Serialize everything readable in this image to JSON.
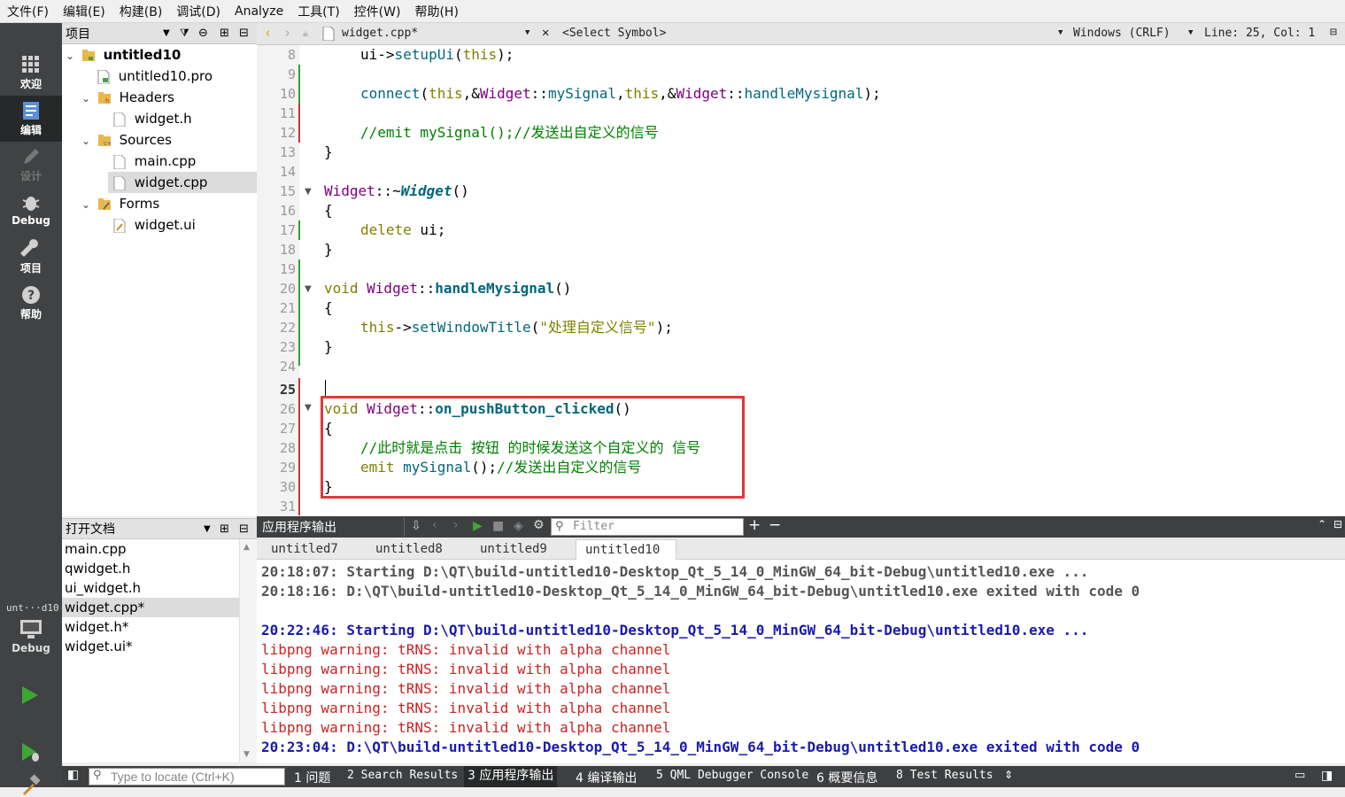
{
  "menu": [
    "文件(F)",
    "编辑(E)",
    "构建(B)",
    "调试(D)",
    "Analyze",
    "工具(T)",
    "控件(W)",
    "帮助(H)"
  ],
  "modes": [
    {
      "label": "欢迎",
      "icon": "grid-icon"
    },
    {
      "label": "编辑",
      "icon": "edit-icon"
    },
    {
      "label": "设计",
      "icon": "pencil-icon"
    },
    {
      "label": "Debug",
      "icon": "bug-icon"
    },
    {
      "label": "项目",
      "icon": "wrench-icon"
    },
    {
      "label": "帮助",
      "icon": "help-icon"
    }
  ],
  "kit": {
    "name": "unt···d10",
    "mode": "Debug"
  },
  "project_panel": {
    "title": "项目",
    "tree": [
      {
        "label": "untitled10",
        "level": 0,
        "expandable": true,
        "bold": true
      },
      {
        "label": "untitled10.pro",
        "level": 1
      },
      {
        "label": "Headers",
        "level": 1,
        "expandable": true
      },
      {
        "label": "widget.h",
        "level": 2
      },
      {
        "label": "Sources",
        "level": 1,
        "expandable": true
      },
      {
        "label": "main.cpp",
        "level": 2
      },
      {
        "label": "widget.cpp",
        "level": 2,
        "selected": true
      },
      {
        "label": "Forms",
        "level": 1,
        "expandable": true
      },
      {
        "label": "widget.ui",
        "level": 2
      }
    ]
  },
  "open_docs": {
    "title": "打开文档",
    "items": [
      "main.cpp",
      "qwidget.h",
      "ui_widget.h",
      "widget.cpp*",
      "widget.h*",
      "widget.ui*"
    ],
    "selected_index": 3
  },
  "editor_toolbar": {
    "file": "widget.cpp*",
    "symbol": "<Select Symbol>",
    "line_ending": "Windows (CRLF)",
    "position": "Line: 25, Col: 1"
  },
  "code_lines": [
    {
      "n": "8"
    },
    {
      "n": "9"
    },
    {
      "n": "10"
    },
    {
      "n": "11"
    },
    {
      "n": "12"
    },
    {
      "n": "13"
    },
    {
      "n": "14"
    },
    {
      "n": "15"
    },
    {
      "n": "16"
    },
    {
      "n": "17"
    },
    {
      "n": "18"
    },
    {
      "n": "19"
    },
    {
      "n": "20"
    },
    {
      "n": "21"
    },
    {
      "n": "22"
    },
    {
      "n": "23"
    },
    {
      "n": "24"
    },
    {
      "n": "25"
    },
    {
      "n": "26"
    },
    {
      "n": "27"
    },
    {
      "n": "28"
    },
    {
      "n": "29"
    },
    {
      "n": "30"
    },
    {
      "n": "31"
    }
  ],
  "code": {
    "l8a": "ui->",
    "l8b": "setupUi",
    "l8c": "(",
    "l8d": "this",
    "l8e": ");",
    "l10a": "connect",
    "l10b": "(",
    "l10c": "this",
    "l10d": ",&",
    "l10e": "Widget",
    "l10f": "::",
    "l10g": "mySignal",
    "l10h": ",",
    "l10i": "this",
    "l10j": ",&",
    "l10k": "Widget",
    "l10l": "::",
    "l10m": "handleMysignal",
    "l10n": ");",
    "l12": "//emit mySignal();//发送出自定义的信号",
    "l13": "}",
    "l15a": "Widget",
    "l15b": "::~",
    "l15c": "Widget",
    "l15d": "()",
    "l16": "{",
    "l17a": "delete",
    "l17b": " ui;",
    "l18": "}",
    "l20a": "void",
    "l20b": " Widget",
    "l20c": "::",
    "l20d": "handleMysignal",
    "l20e": "()",
    "l21": "{",
    "l22a": "this",
    "l22b": "->",
    "l22c": "setWindowTitle",
    "l22d": "(",
    "l22e": "\"处理自定义信号\"",
    "l22f": ");",
    "l23": "}",
    "l26a": "void",
    "l26b": " Widget",
    "l26c": "::",
    "l26d": "on_pushButton_clicked",
    "l26e": "()",
    "l27": "{",
    "l28": "//此时就是点击 按钮 的时候发送这个自定义的 信号",
    "l29a": "emit",
    "l29b": " mySignal",
    "l29c": "();",
    "l29d": "//发送出自定义的信号",
    "l30": "}"
  },
  "output_pane": {
    "title": "应用程序输出",
    "filter_placeholder": "Filter",
    "tabs": [
      "untitled7",
      "untitled8",
      "untitled9",
      "untitled10"
    ],
    "active_tab": 3,
    "lines": [
      {
        "text": "20:18:07: Starting D:\\QT\\build-untitled10-Desktop_Qt_5_14_0_MinGW_64_bit-Debug\\untitled10.exe ...",
        "style": "grey"
      },
      {
        "text": "20:18:16: D:\\QT\\build-untitled10-Desktop_Qt_5_14_0_MinGW_64_bit-Debug\\untitled10.exe exited with code 0",
        "style": "grey"
      },
      {
        "text": "",
        "style": "grey"
      },
      {
        "text": "20:22:46: Starting D:\\QT\\build-untitled10-Desktop_Qt_5_14_0_MinGW_64_bit-Debug\\untitled10.exe ...",
        "style": "blue"
      },
      {
        "text": "libpng warning: tRNS: invalid with alpha channel",
        "style": "red"
      },
      {
        "text": "libpng warning: tRNS: invalid with alpha channel",
        "style": "red"
      },
      {
        "text": "libpng warning: tRNS: invalid with alpha channel",
        "style": "red"
      },
      {
        "text": "libpng warning: tRNS: invalid with alpha channel",
        "style": "red"
      },
      {
        "text": "libpng warning: tRNS: invalid with alpha channel",
        "style": "red"
      },
      {
        "text": "20:23:04: D:\\QT\\build-untitled10-Desktop_Qt_5_14_0_MinGW_64_bit-Debug\\untitled10.exe exited with code 0",
        "style": "blue"
      }
    ]
  },
  "statusbar": {
    "locator_placeholder": "Type to locate (Ctrl+K)",
    "tabs": [
      "1 问题",
      "2 Search Results",
      "3 应用程序输出",
      "4 编译输出",
      "5 QML Debugger Console",
      "6 概要信息",
      "8 Test Results"
    ]
  },
  "colors": {
    "keyword": "#808000",
    "function": "#00677c",
    "class": "#800080",
    "comment": "#008000",
    "highlight_box": "#e0383b"
  }
}
